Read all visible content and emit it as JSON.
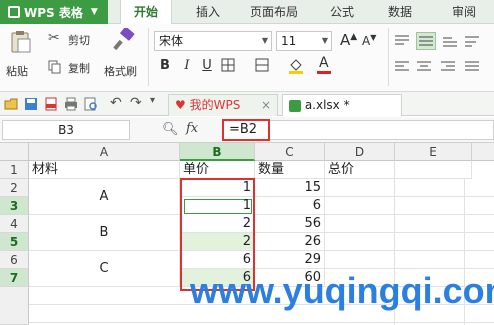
{
  "app": {
    "name": "WPS 表格"
  },
  "menu_tabs": [
    "开始",
    "插入",
    "页面布局",
    "公式",
    "数据",
    "审阅"
  ],
  "ribbon": {
    "paste": "粘贴",
    "cut": "剪切",
    "copy": "复制",
    "format_painter": "格式刷",
    "font_name": "宋体",
    "font_size": "11",
    "grow_font": "A",
    "shrink_font": "A",
    "bold": "B",
    "italic": "I",
    "underline": "U"
  },
  "doc_tabs": {
    "my_wps": "我的WPS",
    "file": "a.xlsx *"
  },
  "formula_bar": {
    "cell_ref": "B3",
    "fx": "fx",
    "formula": "=B2"
  },
  "columns": [
    "A",
    "B",
    "C",
    "D",
    "E"
  ],
  "rows": [
    "1",
    "2",
    "3",
    "4",
    "5",
    "6",
    "7"
  ],
  "cells": {
    "A1": "材料",
    "B1": "单价",
    "C1": "数量",
    "D1": "总价",
    "A2": "A",
    "A4": "B",
    "A6": "C",
    "B2": "1",
    "B3": "1",
    "B4": "2",
    "B5": "2",
    "B6": "6",
    "B7": "6",
    "C2": "15",
    "C3": "6",
    "C4": "56",
    "C5": "26",
    "C6": "29",
    "C7": "60"
  },
  "watermark": "www.yuqingqi.com",
  "colors": {
    "accent": "#3d9b43",
    "highlight": "#e03030",
    "watermark": "#2a7fe0"
  }
}
